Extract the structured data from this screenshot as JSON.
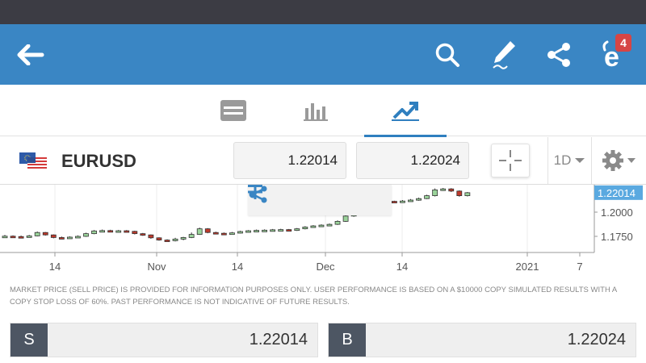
{
  "header": {
    "notification_count": "4"
  },
  "instrument": {
    "symbol": "EURUSD",
    "sell_price": "1.22014",
    "buy_price": "1.22024",
    "period": "1D"
  },
  "chart": {
    "current_price_label": "1.22014",
    "y_ticks": [
      "1.2000",
      "1.1750"
    ],
    "x_ticks": [
      "14",
      "Nov",
      "14",
      "Dec",
      "14",
      "2021",
      "7"
    ]
  },
  "chart_data": {
    "type": "candlestick",
    "x_axis_labels": [
      "14",
      "Nov",
      "14",
      "Dec",
      "14",
      "2021",
      "7"
    ],
    "y_axis_labels": [
      "1.2000",
      "1.1750"
    ],
    "current_price": 1.22014,
    "candles": [
      {
        "o": 1.1748,
        "c": 1.1752,
        "h": 1.1765,
        "l": 1.1735
      },
      {
        "o": 1.1752,
        "c": 1.1748,
        "h": 1.176,
        "l": 1.1738
      },
      {
        "o": 1.1748,
        "c": 1.1745,
        "h": 1.1758,
        "l": 1.1736
      },
      {
        "o": 1.1745,
        "c": 1.1755,
        "h": 1.1765,
        "l": 1.174
      },
      {
        "o": 1.1755,
        "c": 1.179,
        "h": 1.18,
        "l": 1.175
      },
      {
        "o": 1.179,
        "c": 1.1765,
        "h": 1.1795,
        "l": 1.1758
      },
      {
        "o": 1.1765,
        "c": 1.1738,
        "h": 1.177,
        "l": 1.173
      },
      {
        "o": 1.1738,
        "c": 1.1735,
        "h": 1.1748,
        "l": 1.1725
      },
      {
        "o": 1.1735,
        "c": 1.1742,
        "h": 1.175,
        "l": 1.1728
      },
      {
        "o": 1.1742,
        "c": 1.175,
        "h": 1.176,
        "l": 1.1736
      },
      {
        "o": 1.175,
        "c": 1.1778,
        "h": 1.1788,
        "l": 1.1745
      },
      {
        "o": 1.1778,
        "c": 1.1806,
        "h": 1.1815,
        "l": 1.1772
      },
      {
        "o": 1.1806,
        "c": 1.181,
        "h": 1.182,
        "l": 1.1798
      },
      {
        "o": 1.181,
        "c": 1.18,
        "h": 1.1818,
        "l": 1.1792
      },
      {
        "o": 1.18,
        "c": 1.1808,
        "h": 1.1816,
        "l": 1.1794
      },
      {
        "o": 1.1808,
        "c": 1.1802,
        "h": 1.1815,
        "l": 1.1795
      },
      {
        "o": 1.1802,
        "c": 1.1778,
        "h": 1.1808,
        "l": 1.177
      },
      {
        "o": 1.1778,
        "c": 1.1765,
        "h": 1.1785,
        "l": 1.1755
      },
      {
        "o": 1.1765,
        "c": 1.1735,
        "h": 1.177,
        "l": 1.1725
      },
      {
        "o": 1.1735,
        "c": 1.1712,
        "h": 1.174,
        "l": 1.1705
      },
      {
        "o": 1.1712,
        "c": 1.1705,
        "h": 1.172,
        "l": 1.1695
      },
      {
        "o": 1.1705,
        "c": 1.1722,
        "h": 1.1735,
        "l": 1.1698
      },
      {
        "o": 1.1722,
        "c": 1.1738,
        "h": 1.1745,
        "l": 1.171
      },
      {
        "o": 1.1738,
        "c": 1.177,
        "h": 1.179,
        "l": 1.1732
      },
      {
        "o": 1.177,
        "c": 1.1828,
        "h": 1.184,
        "l": 1.1765
      },
      {
        "o": 1.1828,
        "c": 1.179,
        "h": 1.1835,
        "l": 1.1782
      },
      {
        "o": 1.179,
        "c": 1.1782,
        "h": 1.1798,
        "l": 1.1775
      },
      {
        "o": 1.1782,
        "c": 1.178,
        "h": 1.179,
        "l": 1.1772
      },
      {
        "o": 1.178,
        "c": 1.1786,
        "h": 1.1795,
        "l": 1.1776
      },
      {
        "o": 1.1786,
        "c": 1.18,
        "h": 1.1808,
        "l": 1.178
      },
      {
        "o": 1.18,
        "c": 1.1808,
        "h": 1.1815,
        "l": 1.1795
      },
      {
        "o": 1.1808,
        "c": 1.1812,
        "h": 1.182,
        "l": 1.1802
      },
      {
        "o": 1.1812,
        "c": 1.1814,
        "h": 1.1822,
        "l": 1.1806
      },
      {
        "o": 1.1814,
        "c": 1.1818,
        "h": 1.1826,
        "l": 1.1808
      },
      {
        "o": 1.1818,
        "c": 1.182,
        "h": 1.1828,
        "l": 1.1812
      },
      {
        "o": 1.182,
        "c": 1.1812,
        "h": 1.1826,
        "l": 1.1805
      },
      {
        "o": 1.1812,
        "c": 1.1828,
        "h": 1.1836,
        "l": 1.1806
      },
      {
        "o": 1.1828,
        "c": 1.1846,
        "h": 1.1855,
        "l": 1.1822
      },
      {
        "o": 1.1846,
        "c": 1.1858,
        "h": 1.1866,
        "l": 1.184
      },
      {
        "o": 1.1858,
        "c": 1.1866,
        "h": 1.1874,
        "l": 1.1852
      },
      {
        "o": 1.1866,
        "c": 1.1874,
        "h": 1.1882,
        "l": 1.186
      },
      {
        "o": 1.1874,
        "c": 1.1905,
        "h": 1.1915,
        "l": 1.1868
      },
      {
        "o": 1.1905,
        "c": 1.196,
        "h": 1.1972,
        "l": 1.19
      },
      {
        "o": 1.196,
        "c": 1.202,
        "h": 1.203,
        "l": 1.1952
      },
      {
        "o": 1.202,
        "c": 1.2085,
        "h": 1.2095,
        "l": 1.2012
      },
      {
        "o": 1.2085,
        "c": 1.2105,
        "h": 1.2115,
        "l": 1.2078
      },
      {
        "o": 1.2105,
        "c": 1.211,
        "h": 1.212,
        "l": 1.2098
      },
      {
        "o": 1.211,
        "c": 1.2112,
        "h": 1.212,
        "l": 1.2102
      },
      {
        "o": 1.2112,
        "c": 1.2108,
        "h": 1.2118,
        "l": 1.21
      },
      {
        "o": 1.2108,
        "c": 1.2115,
        "h": 1.2125,
        "l": 1.2102
      },
      {
        "o": 1.2115,
        "c": 1.2125,
        "h": 1.2135,
        "l": 1.2108
      },
      {
        "o": 1.2125,
        "c": 1.214,
        "h": 1.215,
        "l": 1.2118
      },
      {
        "o": 1.214,
        "c": 1.217,
        "h": 1.218,
        "l": 1.2135
      },
      {
        "o": 1.217,
        "c": 1.223,
        "h": 1.2245,
        "l": 1.2162
      },
      {
        "o": 1.223,
        "c": 1.224,
        "h": 1.225,
        "l": 1.222
      },
      {
        "o": 1.224,
        "c": 1.2218,
        "h": 1.2248,
        "l": 1.2208
      },
      {
        "o": 1.2218,
        "c": 1.217,
        "h": 1.2225,
        "l": 1.216
      },
      {
        "o": 1.217,
        "c": 1.2201,
        "h": 1.2208,
        "l": 1.2162
      }
    ]
  },
  "disclaimer": "MARKET PRICE (SELL PRICE) IS PROVIDED FOR INFORMATION PURPOSES ONLY. USER PERFORMANCE IS BASED ON A $10000 COPY SIMULATED RESULTS WITH A COPY STOP LOSS OF 60%. PAST PERFORMANCE IS NOT INDICATIVE OF FUTURE RESULTS.",
  "trade": {
    "sell_letter": "S",
    "sell_value": "1.22014",
    "buy_letter": "B",
    "buy_value": "1.22024"
  },
  "colors": {
    "accent": "#3a86c4",
    "candle_up": "#9bd49b",
    "candle_down": "#c0392b",
    "price_tag": "#5aa9e0"
  }
}
